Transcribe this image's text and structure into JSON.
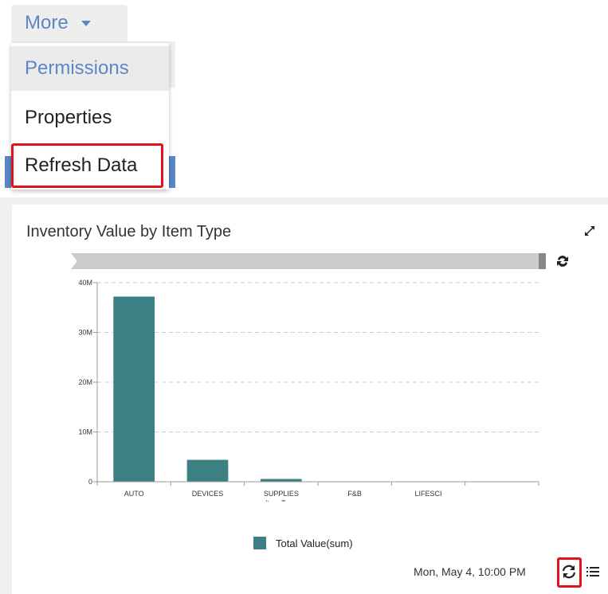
{
  "menu": {
    "button_label": "More",
    "items": [
      "Permissions",
      "Properties",
      "Refresh Data"
    ]
  },
  "panel": {
    "title": "Inventory Value by Item Type",
    "timestamp": "Mon, May 4, 10:00 PM",
    "legend_label": "Total Value(sum)"
  },
  "colors": {
    "accent": "#5b87c8",
    "bar": "#3b8183",
    "highlight": "#e0141b"
  },
  "icons": [
    "chevron-down-icon",
    "expand-icon",
    "sync-icon",
    "refresh-icon",
    "list-icon"
  ],
  "chart_data": {
    "type": "bar",
    "categories": [
      "AUTO",
      "DEVICES",
      "SUPPLIES",
      "F&B",
      "LIFESCI"
    ],
    "series": [
      {
        "name": "Total Value(sum)",
        "values": [
          37200000,
          4400000,
          550000,
          0,
          0
        ]
      }
    ],
    "xlabel": "Item Type",
    "ylabel": "",
    "ylim": [
      0,
      40000000
    ],
    "yticks": [
      0,
      10000000,
      20000000,
      30000000,
      40000000
    ],
    "ytick_labels": [
      "0",
      "10M",
      "20M",
      "30M",
      "40M"
    ],
    "grid": true,
    "legend": "bottom"
  }
}
